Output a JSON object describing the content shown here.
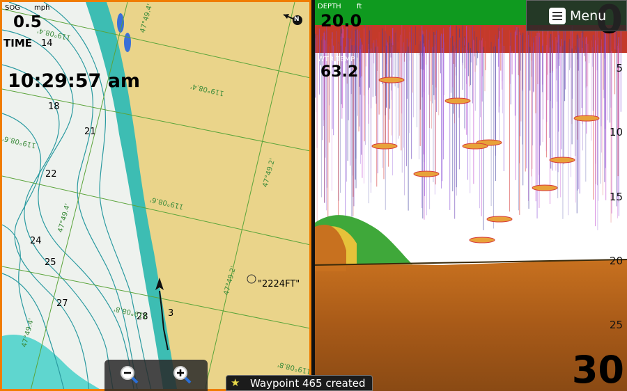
{
  "chart": {
    "sog_label": "SOG",
    "sog_unit": "mph",
    "sog_value": "0.5",
    "time_label": "TIME",
    "time_hours": "14",
    "clock": "10:29:57 am",
    "depth_soundings": [
      "18",
      "21",
      "22",
      "24",
      "25",
      "27",
      "28",
      "3"
    ],
    "grid_labels": [
      "119°08.4'",
      "119°08.4'",
      "119°08.6'",
      "119°08.6'",
      "119°08.8'",
      "119°08.8'",
      "47°49.2'",
      "47°49.2'",
      "47°49.4'",
      "47°49.4'",
      "47°49.4'"
    ],
    "waypoint_label": "\"2224FT\"",
    "north_icon_letter": "N"
  },
  "sonar": {
    "depth_label": "DEPTH",
    "depth_unit": "ft",
    "depth_value": "20.0",
    "water_label": "WTR TEMP",
    "water_value": "63.2",
    "range_top": "0",
    "range_bottom": "30",
    "scale_marks": [
      "5",
      "10",
      "15",
      "20",
      "25"
    ]
  },
  "menu": {
    "label": "Menu",
    "icon": "menu-icon"
  },
  "zoom": {
    "out_icon": "zoom-out-icon",
    "in_icon": "zoom-in-icon"
  },
  "toast": {
    "text": "Waypoint 465 created",
    "icon": "star-icon"
  },
  "colors": {
    "land": "#ead48a",
    "shallow": "#5fd6cf",
    "deep": "#eef2ee",
    "frame": "#f07d00",
    "grid": "#5aa43a",
    "bottom": "#b5651d",
    "depth_bar": "#0f9a1f"
  }
}
